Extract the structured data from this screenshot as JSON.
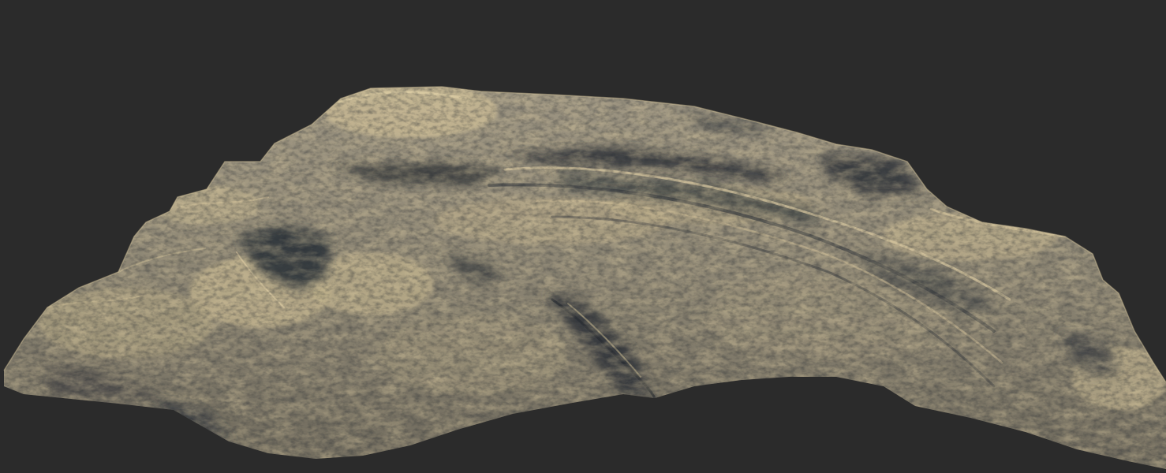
{
  "viewport": {
    "background_color": "#2b2b2b"
  },
  "terrain": {
    "material_light_color": "#c9b994",
    "material_mid_color": "#8f8671",
    "material_shadow_color": "#2f343a"
  }
}
